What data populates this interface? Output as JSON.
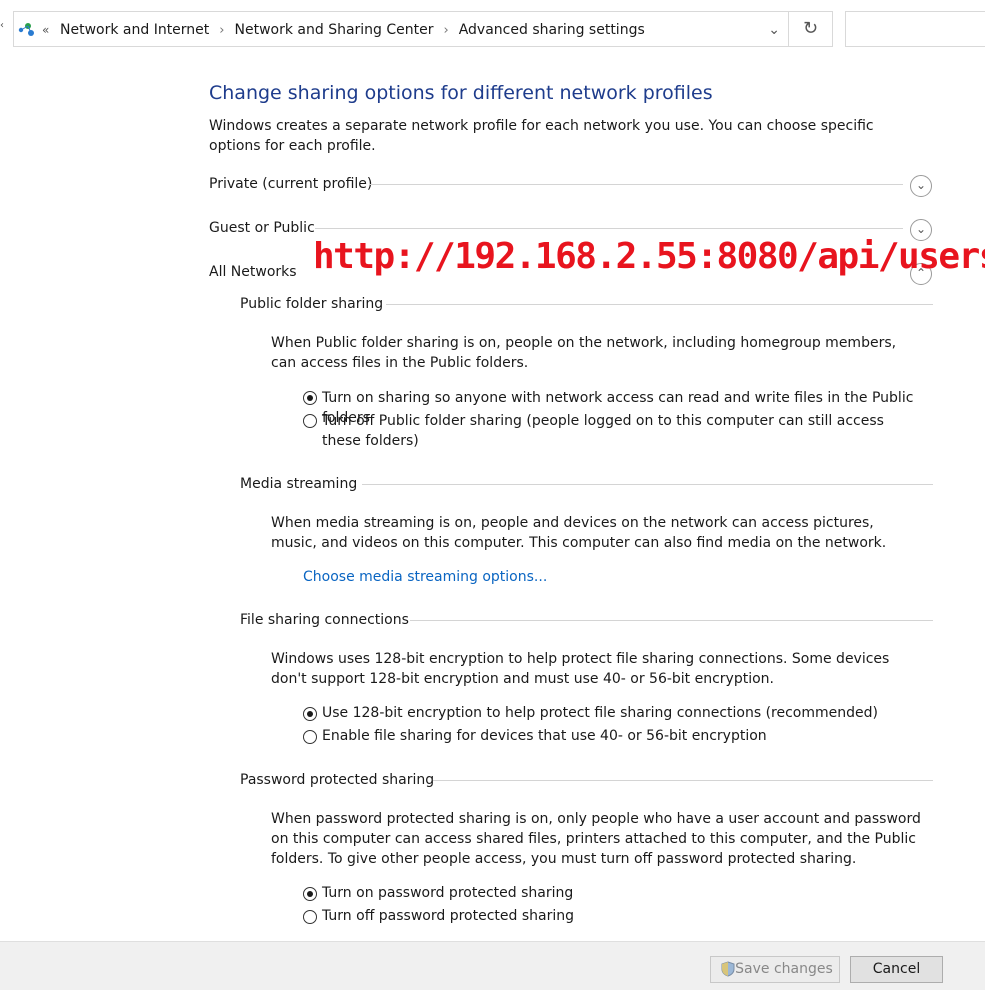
{
  "breadcrumb": {
    "items": [
      "Network and Internet",
      "Network and Sharing Center",
      "Advanced sharing settings"
    ],
    "overflow": "«"
  },
  "page": {
    "title": "Change sharing options for different network profiles",
    "intro": "Windows creates a separate network profile for each network you use. You can choose specific options for each profile."
  },
  "profiles": {
    "private": "Private (current profile)",
    "guest": "Guest or Public",
    "all": "All Networks"
  },
  "watermark": "http://192.168.2.55:8080/api/users",
  "public_folder": {
    "heading": "Public folder sharing",
    "description": "When Public folder sharing is on, people on the network, including homegroup members, can access files in the Public folders.",
    "options": [
      "Turn on sharing so anyone with network access can read and write files in the Public folders",
      "Turn off Public folder sharing (people logged on to this computer can still access these folders)"
    ]
  },
  "media": {
    "heading": "Media streaming",
    "description": "When media streaming is on, people and devices on the network can access pictures, music, and videos on this computer. This computer can also find media on the network.",
    "link": "Choose media streaming options..."
  },
  "file_sharing": {
    "heading": "File sharing connections",
    "description": "Windows uses 128-bit encryption to help protect file sharing connections. Some devices don't support 128-bit encryption and must use 40- or 56-bit encryption.",
    "options": [
      "Use 128-bit encryption to help protect file sharing connections (recommended)",
      "Enable file sharing for devices that use 40- or 56-bit encryption"
    ]
  },
  "password": {
    "heading": "Password protected sharing",
    "description": "When password protected sharing is on, only people who have a user account and password on this computer can access shared files, printers attached to this computer, and the Public folders. To give other people access, you must turn off password protected sharing.",
    "options": [
      "Turn on password protected sharing",
      "Turn off password protected sharing"
    ]
  },
  "footer": {
    "save": "Save changes",
    "cancel": "Cancel"
  }
}
